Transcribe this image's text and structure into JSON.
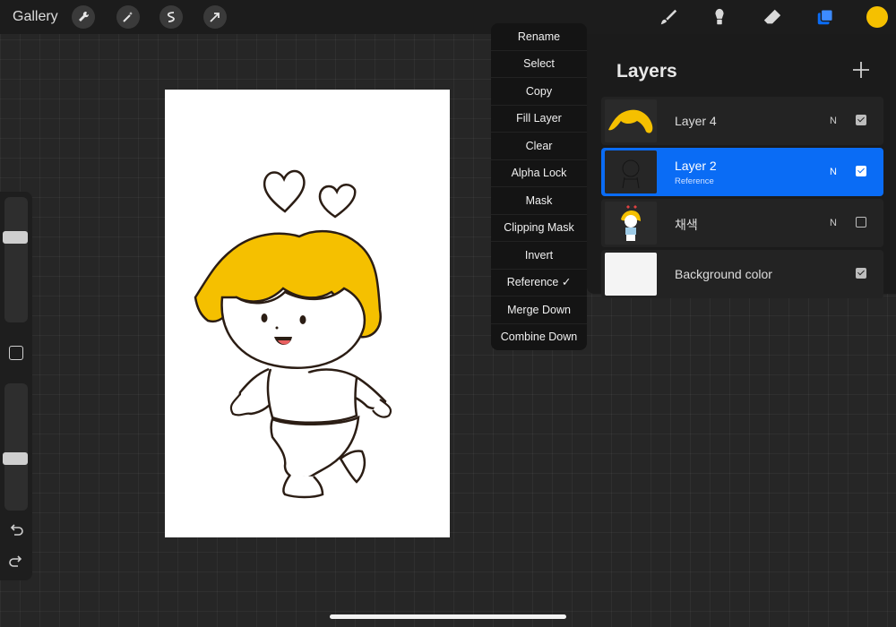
{
  "topbar": {
    "gallery_label": "Gallery",
    "left_tools": [
      "wrench-icon",
      "magic-wand-icon",
      "selection-icon",
      "transform-arrow-icon"
    ],
    "right_tools": [
      "brush-icon",
      "smudge-icon",
      "eraser-icon",
      "layers-icon"
    ],
    "active_color": "#f5c000"
  },
  "sidebar": {
    "brush_size_level": 0.3,
    "opacity_level": 0.6
  },
  "context_menu": {
    "items": [
      "Rename",
      "Select",
      "Copy",
      "Fill Layer",
      "Clear",
      "Alpha Lock",
      "Mask",
      "Clipping Mask",
      "Invert",
      "Reference ✓",
      "Merge Down",
      "Combine Down"
    ]
  },
  "layers": {
    "title": "Layers",
    "items": [
      {
        "name": "Layer 4",
        "blend": "N",
        "visible": true,
        "sub": ""
      },
      {
        "name": "Layer 2",
        "blend": "N",
        "visible": true,
        "sub": "Reference",
        "selected": true
      },
      {
        "name": "채색",
        "blend": "N",
        "visible": false,
        "sub": ""
      },
      {
        "name": "Background color",
        "blend": "",
        "visible": true,
        "sub": ""
      }
    ]
  },
  "colors": {
    "accent": "#0a6cf5",
    "hair": "#f5c000"
  }
}
